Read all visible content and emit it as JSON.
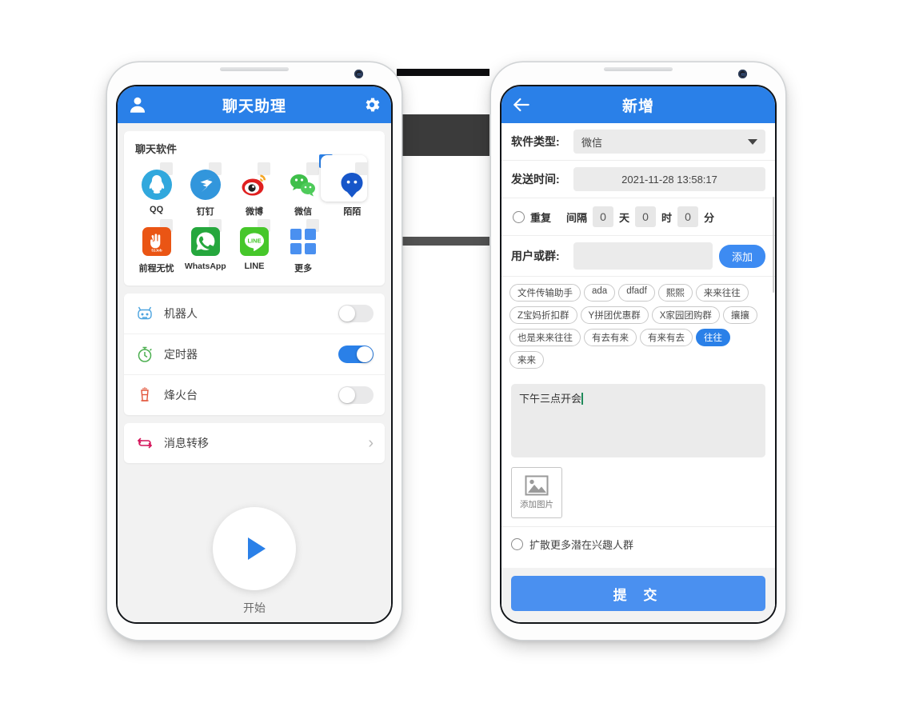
{
  "left_phone": {
    "appbar": {
      "title": "聊天助理",
      "profile_icon": "user-avatar-icon",
      "settings_icon": "gear-icon"
    },
    "software_card": {
      "title": "聊天软件",
      "apps": [
        {
          "label": "QQ",
          "icon": "qq-icon",
          "selected": false
        },
        {
          "label": "钉钉",
          "icon": "dingtalk-icon",
          "selected": false
        },
        {
          "label": "微博",
          "icon": "weibo-icon",
          "selected": false
        },
        {
          "label": "微信",
          "icon": "wechat-icon",
          "selected": true
        },
        {
          "label": "陌陌",
          "icon": "momo-icon",
          "selected": false
        },
        {
          "label": "前程无忧",
          "icon": "51job-icon",
          "selected": false
        },
        {
          "label": "WhatsApp",
          "icon": "whatsapp-icon",
          "selected": false
        },
        {
          "label": "LINE",
          "icon": "line-icon",
          "selected": false
        },
        {
          "label": "更多",
          "icon": "more-grid-icon",
          "selected": false
        }
      ]
    },
    "toggles": [
      {
        "label": "机器人",
        "icon": "robot-icon",
        "on": false
      },
      {
        "label": "定时器",
        "icon": "timer-icon",
        "on": true
      },
      {
        "label": "烽火台",
        "icon": "beacon-icon",
        "on": false
      }
    ],
    "nav_rows": [
      {
        "label": "消息转移",
        "icon": "transfer-icon",
        "chevron": "›"
      }
    ],
    "start": {
      "label": "开始",
      "icon": "play-icon"
    }
  },
  "right_phone": {
    "appbar": {
      "title": "新增",
      "back_icon": "arrow-left-icon"
    },
    "form": {
      "software_type_label": "软件类型:",
      "software_type_value": "微信",
      "send_time_label": "发送时间:",
      "send_time_value": "2021-11-28 13:58:17",
      "repeat_label": "重复",
      "repeat_checked": false,
      "interval_label": "间隔",
      "interval_days": "0",
      "unit_day": "天",
      "interval_hours": "0",
      "unit_hour": "时",
      "interval_minutes": "0",
      "unit_minute": "分",
      "user_or_group_label": "用户或群:",
      "user_or_group_value": "",
      "add_button": "添加"
    },
    "chips": [
      {
        "label": "文件传输助手",
        "active": false
      },
      {
        "label": "ada",
        "active": false
      },
      {
        "label": "dfadf",
        "active": false
      },
      {
        "label": "熙熙",
        "active": false
      },
      {
        "label": "来来往往",
        "active": false
      },
      {
        "label": "Z宝妈折扣群",
        "active": false
      },
      {
        "label": "Y拼团优惠群",
        "active": false
      },
      {
        "label": "X家园团购群",
        "active": false
      },
      {
        "label": "攘攘",
        "active": false
      },
      {
        "label": "也是来来往往",
        "active": false
      },
      {
        "label": "有去有来",
        "active": false
      },
      {
        "label": "有来有去",
        "active": false
      },
      {
        "label": "往往",
        "active": true
      },
      {
        "label": "来来",
        "active": false
      }
    ],
    "message": {
      "value": "下午三点开会"
    },
    "image_upload": {
      "label": "添加图片",
      "icon": "image-placeholder-icon"
    },
    "spread": {
      "label": "扩散更多潜在兴趣人群",
      "checked": false
    },
    "submit_button": "提  交"
  },
  "colors": {
    "accent_blue": "#2a80e8",
    "submit_blue": "#4a90f0",
    "screen_bg": "#f2f2f2",
    "card_bg": "#ffffff",
    "field_bg": "#ebebeb"
  }
}
